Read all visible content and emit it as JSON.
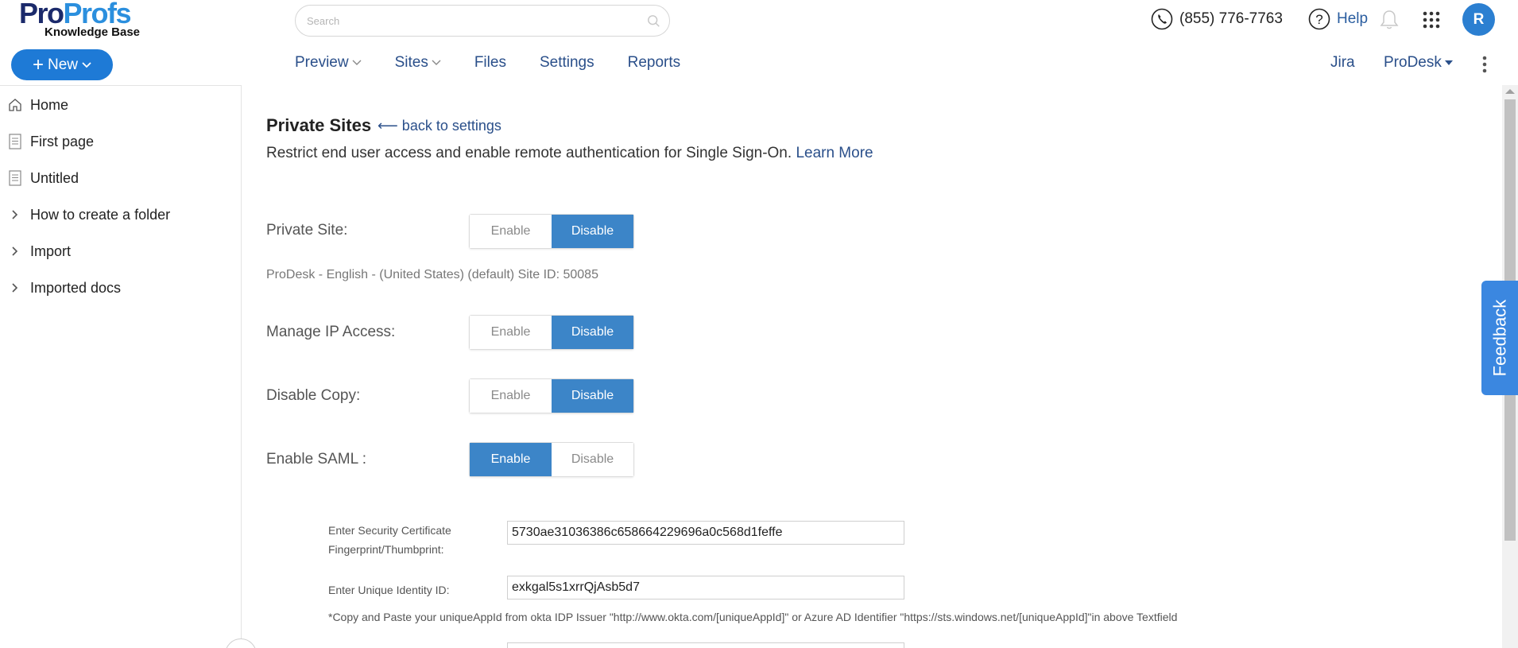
{
  "brand": {
    "logo_pro": "Pro",
    "logo_profs": "Profs",
    "logo_sub": "Knowledge Base"
  },
  "header": {
    "search_placeholder": "Search",
    "phone": "(855) 776-7763",
    "help": "Help",
    "avatar_initial": "R"
  },
  "new_button": {
    "label": "New"
  },
  "topnav": {
    "preview": "Preview",
    "sites": "Sites",
    "files": "Files",
    "settings": "Settings",
    "reports": "Reports",
    "jira": "Jira",
    "prodesk": "ProDesk"
  },
  "sidebar": {
    "items": [
      {
        "label": "Home",
        "icon": "home-icon"
      },
      {
        "label": "First page",
        "icon": "page-icon"
      },
      {
        "label": "Untitled",
        "icon": "page-icon"
      },
      {
        "label": "How to create a folder",
        "icon": "chevron-right-icon"
      },
      {
        "label": "Import",
        "icon": "chevron-right-icon"
      },
      {
        "label": "Imported docs",
        "icon": "chevron-right-icon"
      }
    ]
  },
  "main": {
    "title": "Private Sites",
    "back_link": "⟵ back to settings",
    "description": "Restrict end user access and enable remote authentication for Single Sign-On.",
    "learn_more": "Learn More",
    "site_info": "ProDesk - English - (United States)  (default)   Site ID: 50085",
    "settings": [
      {
        "label": "Private Site:",
        "enable": "Enable",
        "disable": "Disable",
        "selected": "Disable"
      },
      {
        "label": "Manage IP Access:",
        "enable": "Enable",
        "disable": "Disable",
        "selected": "Disable"
      },
      {
        "label": "Disable Copy:",
        "enable": "Enable",
        "disable": "Disable",
        "selected": "Disable"
      },
      {
        "label": "Enable SAML :",
        "enable": "Enable",
        "disable": "Disable",
        "selected": "Enable"
      }
    ],
    "saml": {
      "cert_label_1": "Enter Security Certificate",
      "cert_label_2": "Fingerprint/Thumbprint:",
      "cert_value": "5730ae31036386c658664229696a0c568d1feffe",
      "identity_label": "Enter Unique Identity ID:",
      "identity_value": "exkgal5s1xrrQjAsb5d7",
      "note": "*Copy and Paste your uniqueAppId from okta IDP Issuer \"http://www.okta.com/[uniqueAppId]\" or Azure AD Identifier \"https://sts.windows.net/[uniqueAppId]\"in above Textfield"
    }
  },
  "feedback": {
    "label": "Feedback"
  },
  "colors": {
    "primary": "#1e7ad6",
    "toggle_active": "#3c85c8",
    "nav_text": "#2a4f8a",
    "feedback": "#3b87e0"
  }
}
